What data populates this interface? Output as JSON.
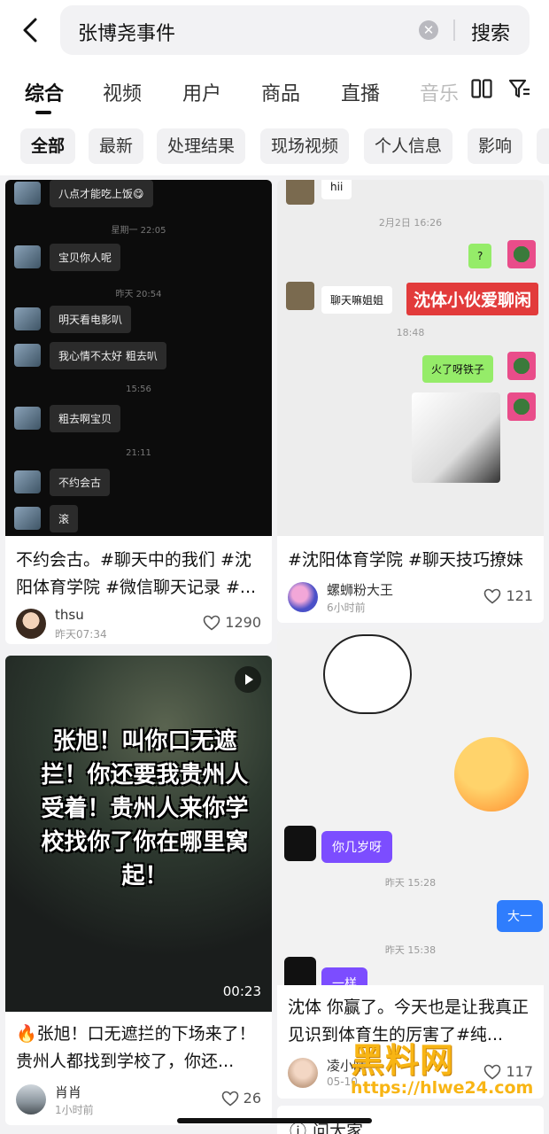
{
  "search": {
    "query": "张博尧事件",
    "button": "搜索"
  },
  "tabs": [
    {
      "label": "综合"
    },
    {
      "label": "视频"
    },
    {
      "label": "用户"
    },
    {
      "label": "商品"
    },
    {
      "label": "直播"
    },
    {
      "label": "音乐"
    }
  ],
  "chips": [
    {
      "label": "全部"
    },
    {
      "label": "最新"
    },
    {
      "label": "处理结果"
    },
    {
      "label": "现场视频"
    },
    {
      "label": "个人信息"
    },
    {
      "label": "影响"
    }
  ],
  "cards": [
    {
      "title": "不约会古。#聊天中的我们 #沈阳体育学院 #微信聊天记录 #...",
      "author": "thsu",
      "time": "昨天07:34",
      "likes": "1290",
      "chat": {
        "m1": "八点才能吃上饭😋",
        "t1": "星期一 22:05",
        "m2": "宝贝你人呢",
        "t2": "昨天 20:54",
        "m3": "明天看电影叭",
        "m4": "我心情不太好 粗去叭",
        "t3": "15:56",
        "m5": "粗去啊宝贝",
        "t4": "21:11",
        "m6": "不约会古",
        "m7": "滚"
      }
    },
    {
      "title": "#沈阳体育学院 #聊天技巧撩妹",
      "author": "螺蛳粉大王",
      "time": "6小时前",
      "likes": "121",
      "chat": {
        "m1": "hii",
        "t1": "2月2日 16:26",
        "m2": "?",
        "m3": "聊天嘛姐姐",
        "red": "沈体小伙爱聊闲",
        "t2": "18:48",
        "m4": "火了呀铁子"
      }
    },
    {
      "title": "🔥张旭！口无遮拦的下场来了！贵州人都找到学校了，你还...",
      "author": "肖肖",
      "time": "1小时前",
      "likes": "26",
      "overlay": "张旭！叫你口无遮拦！你还要我贵州人受着！贵州人来你学校找你了你在哪里窝起！",
      "duration": "00:23"
    },
    {
      "title": "沈体 你赢了。今天也是让我真正见识到体育生的厉害了#纯...",
      "author": "凌小晴",
      "time": "05-10",
      "likes": "117",
      "chat": {
        "m1": "你几岁呀",
        "t1": "昨天 15:28",
        "m2": "大一",
        "t2": "昨天 15:38",
        "m3": "一样"
      }
    }
  ],
  "next_card_title": "问大家",
  "watermark": {
    "title": "黑料网",
    "url": "https://hlwe24.com"
  },
  "colors": {
    "accent_red": "#e23b3b",
    "wechat_green": "#95ec69",
    "watermark": "#f8b514"
  }
}
